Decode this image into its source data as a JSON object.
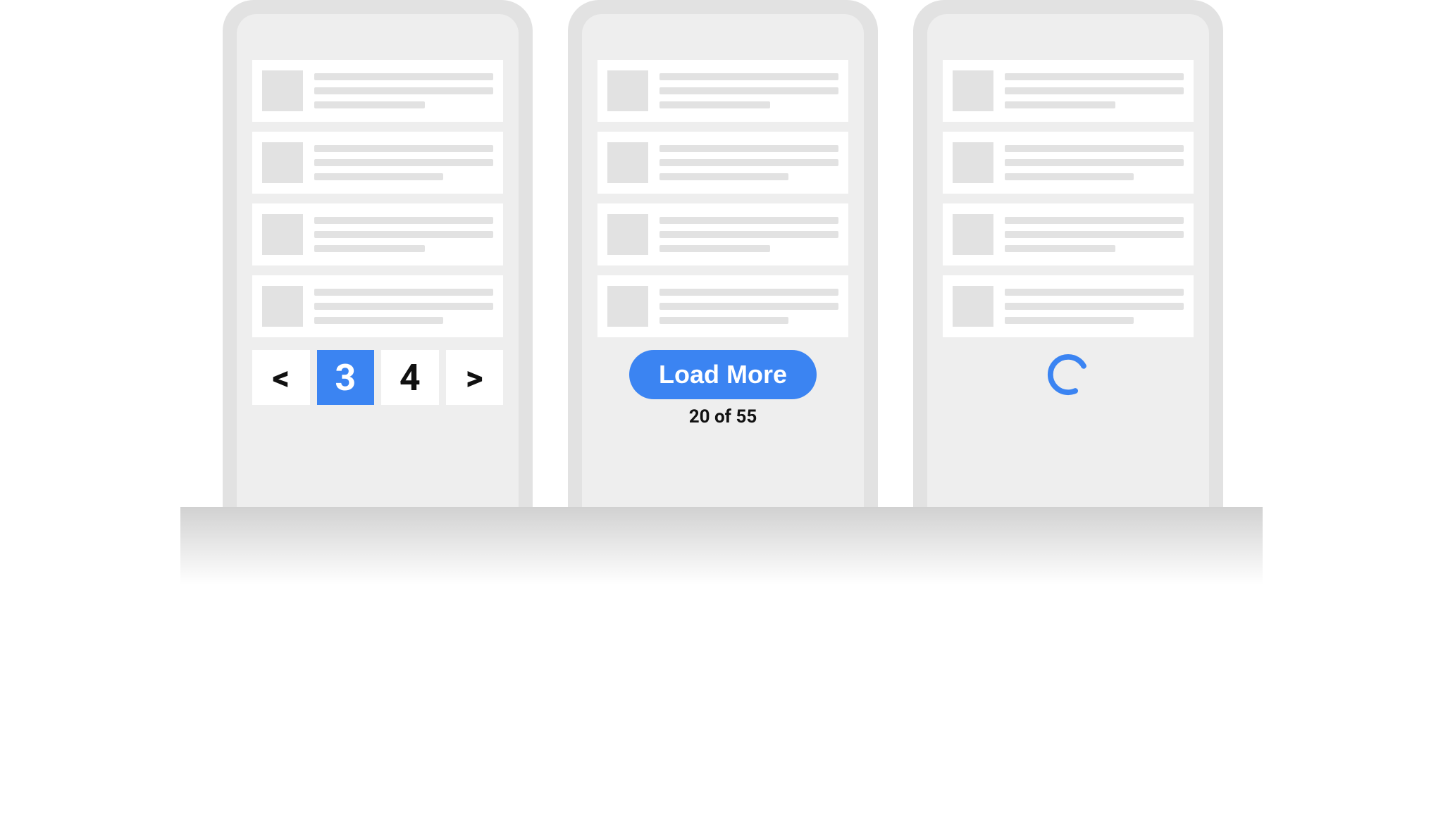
{
  "accent_color": "#3b84f2",
  "devices": {
    "pagination": {
      "prev_glyph": "<",
      "pages": [
        "3",
        "4"
      ],
      "active_page": "3",
      "next_glyph": ">"
    },
    "loadmore": {
      "button_label": "Load More",
      "count_text": "20 of 55"
    },
    "infinite": {
      "spinner_name": "loading-spinner"
    }
  }
}
